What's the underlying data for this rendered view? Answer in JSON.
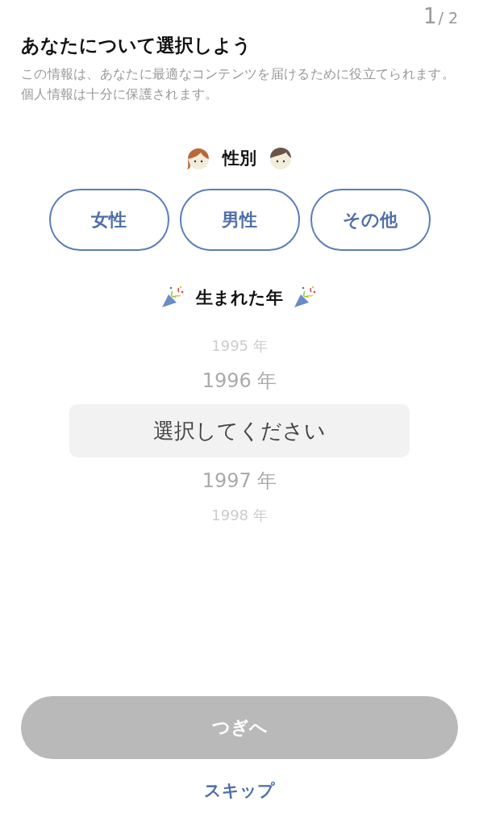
{
  "page_counter": {
    "current": "1",
    "total": "/ 2"
  },
  "title": "あなたについて選択しよう",
  "description": "この情報は、あなたに最適なコンテンツを届けるために役立てられます。個人情報は十分に保護されます。",
  "gender": {
    "heading": "性別",
    "options": [
      {
        "label": "女性",
        "selected": false
      },
      {
        "label": "男性",
        "selected": false
      },
      {
        "label": "その他",
        "selected": false
      }
    ]
  },
  "birth_year": {
    "heading": "生まれた年",
    "items": [
      {
        "label": "1995 年",
        "selected": false
      },
      {
        "label": "1996 年",
        "selected": false
      },
      {
        "label": "選択してください",
        "selected": true
      },
      {
        "label": "1997 年",
        "selected": false
      },
      {
        "label": "1998 年",
        "selected": false
      }
    ]
  },
  "next_button": {
    "label": "つぎへ",
    "disabled": true
  },
  "skip_link": "スキップ"
}
